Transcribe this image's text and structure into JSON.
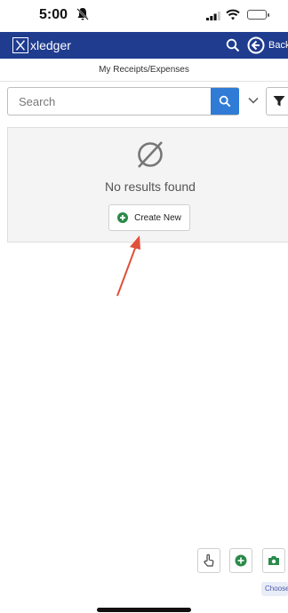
{
  "status_bar": {
    "time": "5:00",
    "icons": [
      "bell-muted-icon",
      "signal-icon",
      "wifi-icon",
      "battery-icon"
    ]
  },
  "header": {
    "logo_text": "xledger",
    "back_label": "Back",
    "icons": [
      "xledger-logo-icon",
      "search-icon",
      "back-arrow-icon"
    ],
    "brand_color": "#1f3c8f"
  },
  "page": {
    "title": "My Receipts/Expenses"
  },
  "search": {
    "placeholder": "Search",
    "value": "",
    "icons": [
      "search-icon",
      "chevron-down-icon",
      "filter-icon"
    ],
    "button_color": "#2f7bd6"
  },
  "results": {
    "empty_icon": "empty-set-icon",
    "empty_message": "No results found",
    "create_button_label": "Create New",
    "create_icon": "plus-circle-icon",
    "accent_color": "#2a8a4a"
  },
  "annotation": {
    "type": "arrow",
    "color": "#e0503a"
  },
  "floating_actions": {
    "icons": [
      "touch-icon",
      "add-circle-icon",
      "camera-icon"
    ],
    "choose_label": "Choose"
  }
}
